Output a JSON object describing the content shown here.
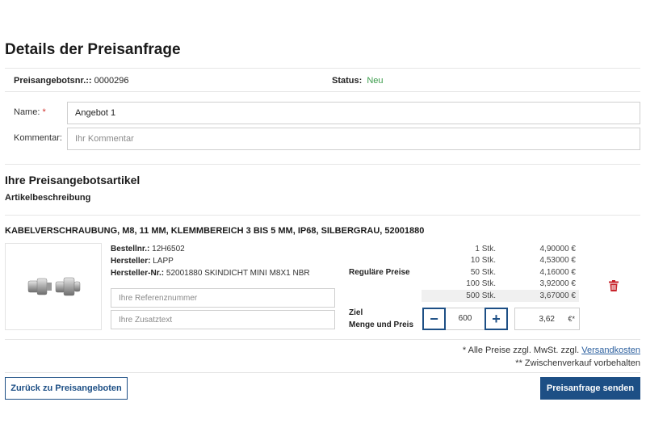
{
  "page": {
    "title": "Details der Preisanfrage"
  },
  "info": {
    "quote_no_label": "Preisangebotsnr.::",
    "quote_no_value": "0000296",
    "status_label": "Status:",
    "status_value": "Neu"
  },
  "form": {
    "name_label": "Name:",
    "name_required": "*",
    "name_value": "Angebot 1",
    "comment_label": "Kommentar:",
    "comment_placeholder": "Ihr Kommentar"
  },
  "section": {
    "title": "Ihre Preisangebotsartikel",
    "subtitle": "Artikelbeschreibung"
  },
  "product": {
    "title": "KABELVERSCHRAUBUNG, M8, 11 MM, KLEMMBEREICH 3 BIS 5 MM, IP68, SILBERGRAU, 52001880",
    "order_no_label": "Bestellnr.:",
    "order_no_value": "12H6502",
    "manufacturer_label": "Hersteller:",
    "manufacturer_value": "LAPP",
    "mfr_no_label": "Hersteller-Nr.:",
    "mfr_no_value": "52001880 SKINDICHT MINI M8X1 NBR",
    "ref_placeholder": "Ihre Referenznummer",
    "extra_placeholder": "Ihre Zusatztext",
    "regular_prices_label": "Reguläre Preise",
    "price_tiers": [
      {
        "qty": "1 Stk.",
        "price": "4,90000 €",
        "active": false
      },
      {
        "qty": "10 Stk.",
        "price": "4,53000 €",
        "active": false
      },
      {
        "qty": "50 Stk.",
        "price": "4,16000 €",
        "active": false
      },
      {
        "qty": "100 Stk.",
        "price": "3,92000 €",
        "active": false
      },
      {
        "qty": "500 Stk.",
        "price": "3,67000 €",
        "active": true
      }
    ],
    "target_label_line1": "Ziel",
    "target_label_line2": "Menge und Preis",
    "minus_label": "−",
    "plus_label": "+",
    "quantity": "600",
    "target_price": "3,62",
    "target_currency": "€*",
    "icons": {
      "delete": "trash-icon",
      "product": "product-image"
    }
  },
  "footer": {
    "note1_prefix": "* Alle Preise zzgl. MwSt. zzgl. ",
    "note1_link": "Versandkosten",
    "note2": "** Zwischenverkauf vorbehalten",
    "back_button": "Zurück zu Preisangeboten",
    "send_button": "Preisanfrage senden"
  },
  "colors": {
    "primary": "#1d4f85",
    "status": "#3a9b4a",
    "required": "#d0312d",
    "delete": "#c8242c"
  }
}
